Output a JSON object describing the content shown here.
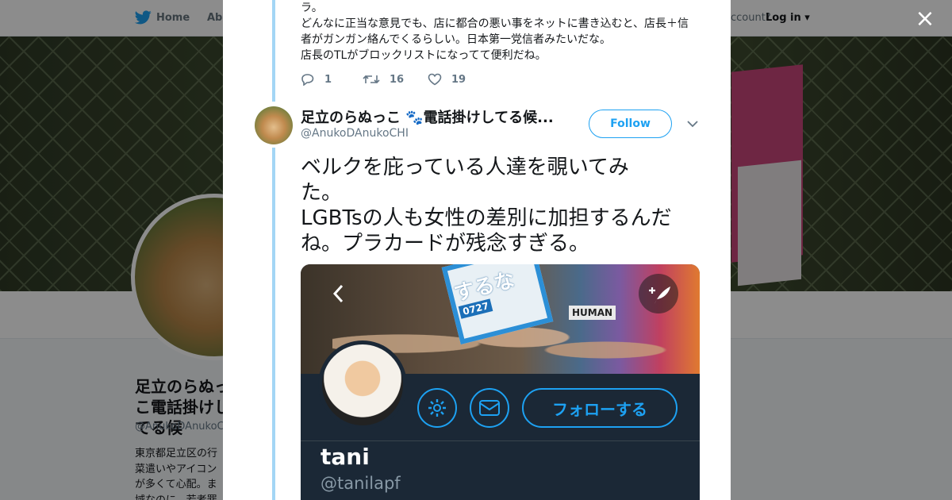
{
  "background": {
    "nav": {
      "home_label": "Home",
      "about_label": "Abo",
      "account_text": "ccount?",
      "login_label": "Log in"
    },
    "profile": {
      "name": "足立のらぬっこ電話掛けしてる候",
      "handle": "@AnukoDAnukoCH",
      "bio": [
        "東京都足立区の行",
        "菜遣いやアイコン",
        "が多くて心配。ま",
        "域なのに、若者罪"
      ]
    }
  },
  "modal": {
    "close_label": "×",
    "prev_tweet": {
      "lines": [
        "ラ。",
        "どんなに正当な意見でも、店に都合の悪い事をネットに書き込むと、店長＋信",
        "者がガンガン絡んでくるらしい。日本第一党信者みたいだな。",
        "店長のTLがブロックリストになってて便利だね。"
      ],
      "reply_count": "1",
      "retweet_count": "16",
      "like_count": "19"
    },
    "tweet": {
      "author_name": "足立のらぬっこ 🐾電話掛けしてる候...",
      "author_handle": "@AnukoDAnukoCHI",
      "follow_label": "Follow",
      "text_lines": [
        "ベルクを庇っている人達を覗いてみ",
        "た。",
        "LGBTsの人も女性の差別に加担するんだ",
        "ね。プラカードが残念すぎる。"
      ]
    },
    "media": {
      "placard_text": "するな",
      "placard_number": "0727",
      "human_text": "HUMAN",
      "follow_button_label": "フォローする",
      "profile_name": "tani",
      "profile_handle": "@tanilapf"
    }
  },
  "colors": {
    "accent": "#1da1f2",
    "thread": "#a3d6f5",
    "media_bg": "#1b2836"
  }
}
